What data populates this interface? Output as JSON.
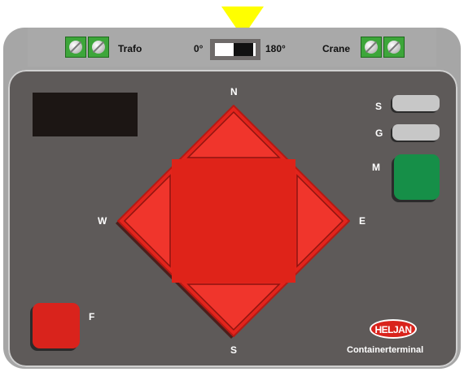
{
  "top_bar": {
    "trafo_label": "Trafo",
    "crane_label": "Crane",
    "angle_min_label": "0°",
    "angle_max_label": "180°"
  },
  "rotation_switch": {
    "value": 1
  },
  "direction_pad": {
    "north_label": "N",
    "south_label": "S",
    "west_label": "W",
    "east_label": "E"
  },
  "buttons": {
    "s_label": "S",
    "g_label": "G",
    "m_label": "M",
    "f_label": "F"
  },
  "brand": {
    "logo_text": "HELJAN",
    "subtitle": "Containerterminal"
  },
  "colors": {
    "housing": "#a6a6a6",
    "panel": "#5e5a59",
    "pad_red": "#e3241c",
    "button_green": "#168f48",
    "terminal_green": "#3da63a",
    "pointer_yellow": "#ffff00"
  },
  "icons": {
    "terminals": "screw-terminal",
    "pointer": "yellow-down-arrow",
    "pad_arrows": "triangle-arrow"
  }
}
